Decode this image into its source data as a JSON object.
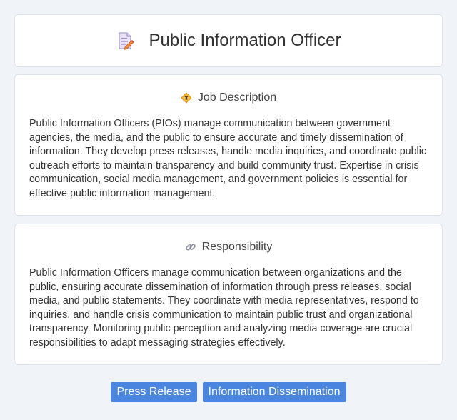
{
  "header": {
    "title": "Public Information Officer",
    "icon": "document-edit-icon"
  },
  "job_description": {
    "title": "Job Description",
    "icon": "diamond-badge-icon",
    "text": "Public Information Officers (PIOs) manage communication between government agencies, the media, and the public to ensure accurate and timely dissemination of information. They develop press releases, handle media inquiries, and coordinate public outreach efforts to maintain transparency and build community trust. Expertise in crisis communication, social media management, and government policies is essential for effective public information management."
  },
  "responsibility": {
    "title": "Responsibility",
    "icon": "link-icon",
    "text": "Public Information Officers manage communication between organizations and the public, ensuring accurate dissemination of information through press releases, social media, and public statements. They coordinate with media representatives, respond to inquiries, and handle crisis communication to maintain public trust and organizational transparency. Monitoring public perception and analyzing media coverage are crucial responsibilities to adapt messaging strategies effectively."
  },
  "tags": [
    "Press Release",
    "Information Dissemination"
  ],
  "colors": {
    "background": "#f0f3f8",
    "tag_background": "#4a86e0"
  }
}
